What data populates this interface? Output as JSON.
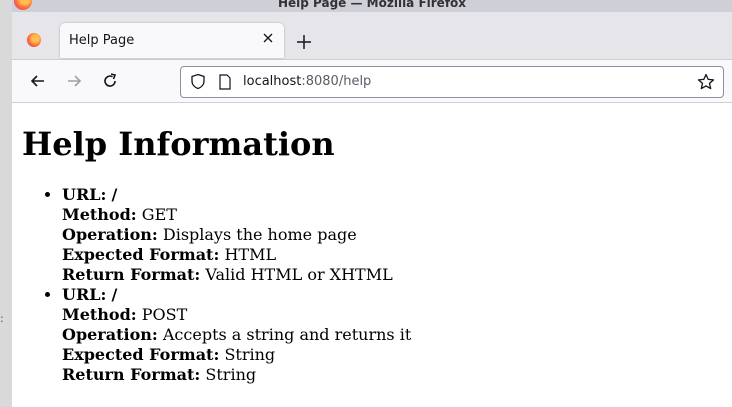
{
  "window": {
    "title": "Help Page — Mozilla Firefox"
  },
  "tab": {
    "label": "Help Page"
  },
  "url": {
    "host": "localhost",
    "port_path": ":8080/help"
  },
  "page": {
    "heading": "Help Information",
    "endpoints": [
      {
        "url_label": "URL:",
        "url": "/",
        "method_label": "Method:",
        "method": "GET",
        "operation_label": "Operation:",
        "operation": "Displays the home page",
        "expected_label": "Expected Format:",
        "expected": "HTML",
        "return_label": "Return Format:",
        "return": "Valid HTML or XHTML"
      },
      {
        "url_label": "URL:",
        "url": "/",
        "method_label": "Method:",
        "method": "POST",
        "operation_label": "Operation:",
        "operation": "Accepts a string and returns it",
        "expected_label": "Expected Format:",
        "expected": "String",
        "return_label": "Return Format:",
        "return": "String"
      }
    ]
  },
  "icons": [
    "firefox-icon",
    "close-icon",
    "plus-icon",
    "back-arrow-icon",
    "forward-arrow-icon",
    "reload-icon",
    "shield-icon",
    "page-icon",
    "star-icon"
  ],
  "colors": {
    "titlebar": "#cfcfd8",
    "tabstrip": "#e5e5ea",
    "toolbar": "#f9f9fb",
    "url_path": "#5b5b66"
  }
}
